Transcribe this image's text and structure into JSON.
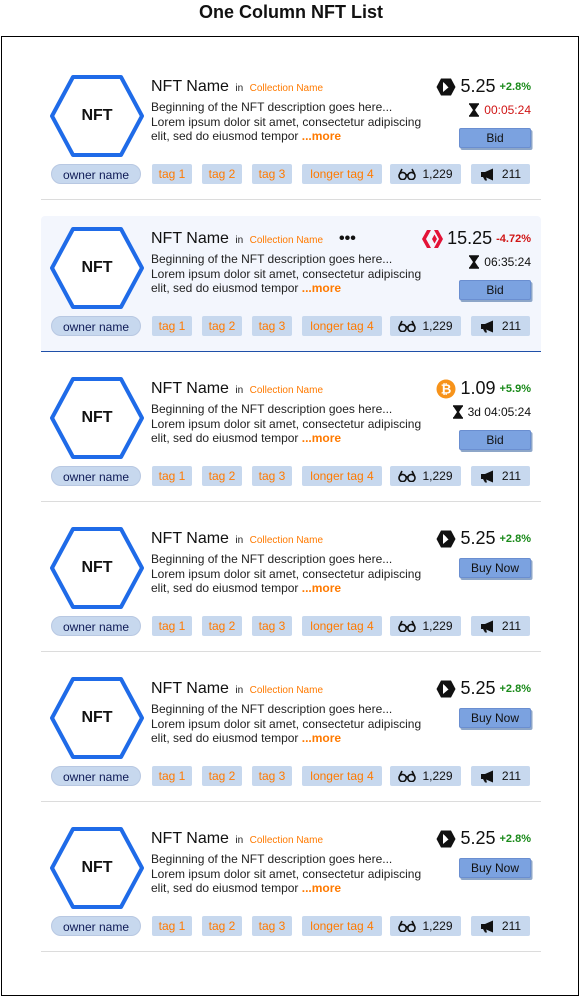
{
  "page": {
    "title": "One Column NFT List"
  },
  "colors": {
    "hex_border": "#1f6be8",
    "accent_orange": "#ff7a00",
    "positive": "#1a8a1a",
    "negative": "#d01515",
    "chip_bg": "#c7d8ee",
    "button_bg": "#7ba2e0"
  },
  "items": [
    {
      "name": "NFT Name",
      "in_label": "in",
      "collection": "Collection Name",
      "image_label": "NFT",
      "description": "Beginning of the NFT description goes here... Lorem ipsum dolor sit amet, consectetur adipiscing elit, sed do eiusmod tempor ",
      "more": "...more",
      "coin_icon": "hexagon-coin-icon",
      "price": "5.25",
      "change": "+2.8%",
      "change_color": "#1a8a1a",
      "timer": "00:05:24",
      "timer_color": "#d01515",
      "button": "Bid",
      "owner": "owner name",
      "tags": [
        "tag 1",
        "tag 2",
        "tag 3",
        "longer tag 4"
      ],
      "views": "1,229",
      "promotions": "211"
    },
    {
      "name": "NFT Name",
      "in_label": "in",
      "collection": "Collection Name",
      "image_label": "NFT",
      "menu": "•••",
      "description": "Beginning of the NFT description goes here... Lorem ipsum dolor sit amet, consectetur adipiscing elit, sed do eiusmod tempor ",
      "more": "...more",
      "coin_icon": "hive-coin-icon",
      "price": "15.25",
      "change": "-4.72%",
      "change_color": "#d01515",
      "timer": "06:35:24",
      "timer_color": "#111111",
      "button": "Bid",
      "owner": "owner name",
      "tags": [
        "tag 1",
        "tag 2",
        "tag 3",
        "longer tag 4"
      ],
      "views": "1,229",
      "promotions": "211"
    },
    {
      "name": "NFT Name",
      "in_label": "in",
      "collection": "Collection Name",
      "image_label": "NFT",
      "description": "Beginning of the NFT description goes here... Lorem ipsum dolor sit amet, consectetur adipiscing elit, sed do eiusmod tempor ",
      "more": "...more",
      "coin_icon": "bitcoin-coin-icon",
      "price": "1.09",
      "change": "+5.9%",
      "change_color": "#1a8a1a",
      "timer": "3d 04:05:24",
      "timer_color": "#111111",
      "button": "Bid",
      "owner": "owner name",
      "tags": [
        "tag 1",
        "tag 2",
        "tag 3",
        "longer tag 4"
      ],
      "views": "1,229",
      "promotions": "211"
    },
    {
      "name": "NFT Name",
      "in_label": "in",
      "collection": "Collection Name",
      "image_label": "NFT",
      "description": "Beginning of the NFT description goes here... Lorem ipsum dolor sit amet, consectetur adipiscing elit, sed do eiusmod tempor ",
      "more": "...more",
      "coin_icon": "hexagon-coin-icon",
      "price": "5.25",
      "change": "+2.8%",
      "change_color": "#1a8a1a",
      "button": "Buy Now",
      "owner": "owner name",
      "tags": [
        "tag 1",
        "tag 2",
        "tag 3",
        "longer tag 4"
      ],
      "views": "1,229",
      "promotions": "211"
    },
    {
      "name": "NFT Name",
      "in_label": "in",
      "collection": "Collection Name",
      "image_label": "NFT",
      "description": "Beginning of the NFT description goes here... Lorem ipsum dolor sit amet, consectetur adipiscing elit, sed do eiusmod tempor ",
      "more": "...more",
      "coin_icon": "hexagon-coin-icon",
      "price": "5.25",
      "change": "+2.8%",
      "change_color": "#1a8a1a",
      "button": "Buy Now",
      "owner": "owner name",
      "tags": [
        "tag 1",
        "tag 2",
        "tag 3",
        "longer tag 4"
      ],
      "views": "1,229",
      "promotions": "211"
    },
    {
      "name": "NFT Name",
      "in_label": "in",
      "collection": "Collection Name",
      "image_label": "NFT",
      "description": "Beginning of the NFT description goes here... Lorem ipsum dolor sit amet, consectetur adipiscing elit, sed do eiusmod tempor ",
      "more": "...more",
      "coin_icon": "hexagon-coin-icon",
      "price": "5.25",
      "change": "+2.8%",
      "change_color": "#1a8a1a",
      "button": "Buy Now",
      "owner": "owner name",
      "tags": [
        "tag 1",
        "tag 2",
        "tag 3",
        "longer tag 4"
      ],
      "views": "1,229",
      "promotions": "211"
    }
  ]
}
